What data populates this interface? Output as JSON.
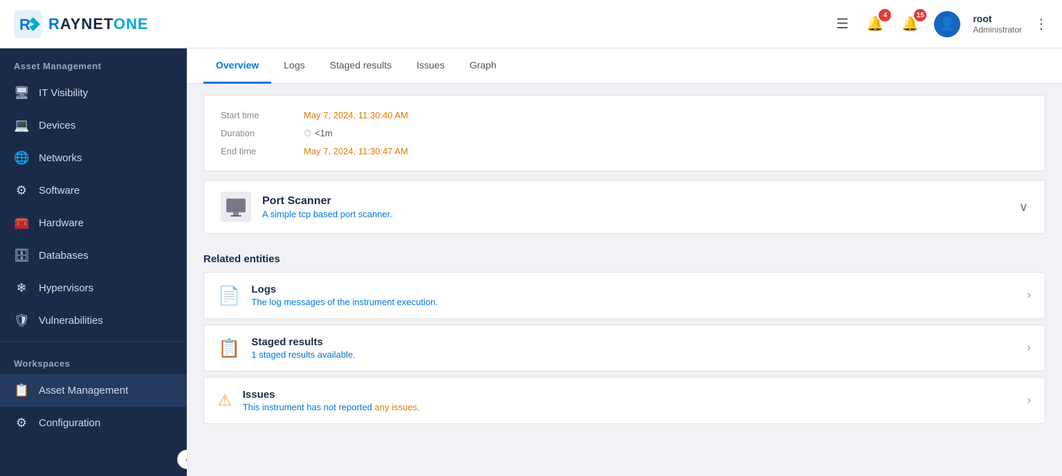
{
  "header": {
    "logo_text_r": "R",
    "logo_text_main": "AYNETONE",
    "notifications_badge": "4",
    "alerts_badge": "15",
    "user_name": "root",
    "user_role": "Administrator",
    "more_label": "⋮"
  },
  "sidebar": {
    "section1_title": "Asset Management",
    "items": [
      {
        "id": "it-visibility",
        "label": "IT Visibility",
        "icon": "☰"
      },
      {
        "id": "devices",
        "label": "Devices",
        "icon": "🖥"
      },
      {
        "id": "networks",
        "label": "Networks",
        "icon": "🌐"
      },
      {
        "id": "software",
        "label": "Software",
        "icon": "⚙"
      },
      {
        "id": "hardware",
        "label": "Hardware",
        "icon": "🧰"
      },
      {
        "id": "databases",
        "label": "Databases",
        "icon": "🗄"
      },
      {
        "id": "hypervisors",
        "label": "Hypervisors",
        "icon": "❄"
      },
      {
        "id": "vulnerabilities",
        "label": "Vulnerabilities",
        "icon": "🛡"
      }
    ],
    "section2_title": "Workspaces",
    "workspace_items": [
      {
        "id": "asset-management",
        "label": "Asset Management",
        "icon": "📋",
        "active": true
      },
      {
        "id": "configuration",
        "label": "Configuration",
        "icon": "⚙"
      }
    ],
    "collapse_icon": "‹"
  },
  "tabs": [
    {
      "id": "overview",
      "label": "Overview",
      "active": true
    },
    {
      "id": "logs",
      "label": "Logs"
    },
    {
      "id": "staged-results",
      "label": "Staged results"
    },
    {
      "id": "issues",
      "label": "Issues"
    },
    {
      "id": "graph",
      "label": "Graph"
    }
  ],
  "detail": {
    "start_time_label": "Start time",
    "start_time_value": "May 7, 2024, 11:30:40 AM",
    "duration_label": "Duration",
    "duration_value": "<1m",
    "end_time_label": "End time",
    "end_time_value": "May 7, 2024, 11:30:47 AM"
  },
  "port_scanner": {
    "title": "Port Scanner",
    "description_pre": "A simple ",
    "description_link": "tcp",
    "description_post": " based port scanner."
  },
  "related_entities": {
    "section_title": "Related entities",
    "items": [
      {
        "id": "logs",
        "title": "Logs",
        "description": "The log messages of the instrument execution.",
        "has_link": false
      },
      {
        "id": "staged-results",
        "title": "Staged results",
        "description_pre": "1 staged results available.",
        "has_count": true
      },
      {
        "id": "issues",
        "title": "Issues",
        "description": "This instrument has not reported any issues."
      }
    ]
  }
}
